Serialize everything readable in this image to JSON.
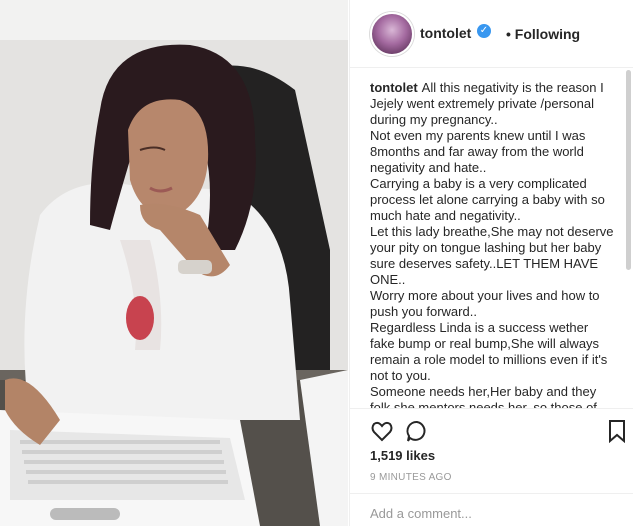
{
  "post": {
    "username": "tontolet",
    "status": "• Following",
    "verified_icon": "verified-badge-icon",
    "caption": [
      "All this negativity is the reason I Jejely went extremely private /personal during my pregnancy..",
      "Not even my parents knew until I was 8months and far away from the world negativity and hate..",
      "Carrying a baby is a very complicated process let alone carrying a baby with so much hate and negativity..",
      "Let this lady breathe,She may not deserve your pity on tongue lashing but her baby sure deserves safety..LET THEM HAVE ONE..",
      "Worry more about your lives and how to push you forward..",
      "Regardless Linda is a success wether fake bump or real bump,She will always remain a role model to millions even if it's not to you.",
      "Someone needs her,Her baby and they folk she mentors needs her. so those of you who don't need her leave her alone."
    ],
    "likes": "1,519 likes",
    "time": "9 MINUTES AGO",
    "comment_placeholder": "Add a comment..."
  },
  "icons": [
    "heart-icon",
    "comment-icon",
    "bookmark-icon"
  ]
}
